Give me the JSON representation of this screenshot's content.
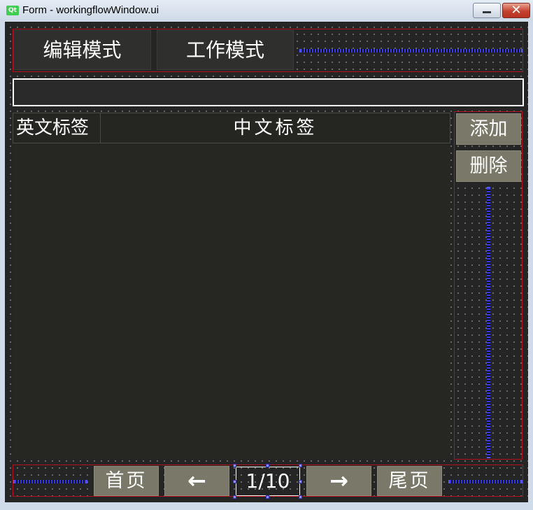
{
  "window": {
    "app_icon": "Qt",
    "title": "Form - workingflowWindow.ui",
    "minimize_icon": "minimize-icon",
    "close_icon": "close-icon",
    "close_glyph": "✕"
  },
  "toolbar": {
    "edit_mode_label": "编辑模式",
    "work_mode_label": "工作模式"
  },
  "search": {
    "value": ""
  },
  "table": {
    "columns": [
      "英文标签",
      "中文标签"
    ],
    "rows": []
  },
  "side_actions": {
    "add_label": "添加",
    "delete_label": "删除"
  },
  "pager": {
    "first_label": "首页",
    "prev_label": "←",
    "page_indicator": "1/10",
    "next_label": "→",
    "last_label": "尾页"
  },
  "colors": {
    "canvas_bg": "#252525",
    "button_bg": "#2f2f2d",
    "serif_button_bg": "#7a7868",
    "layout_border": "#b2111e",
    "spacer": "#3a3af0"
  }
}
